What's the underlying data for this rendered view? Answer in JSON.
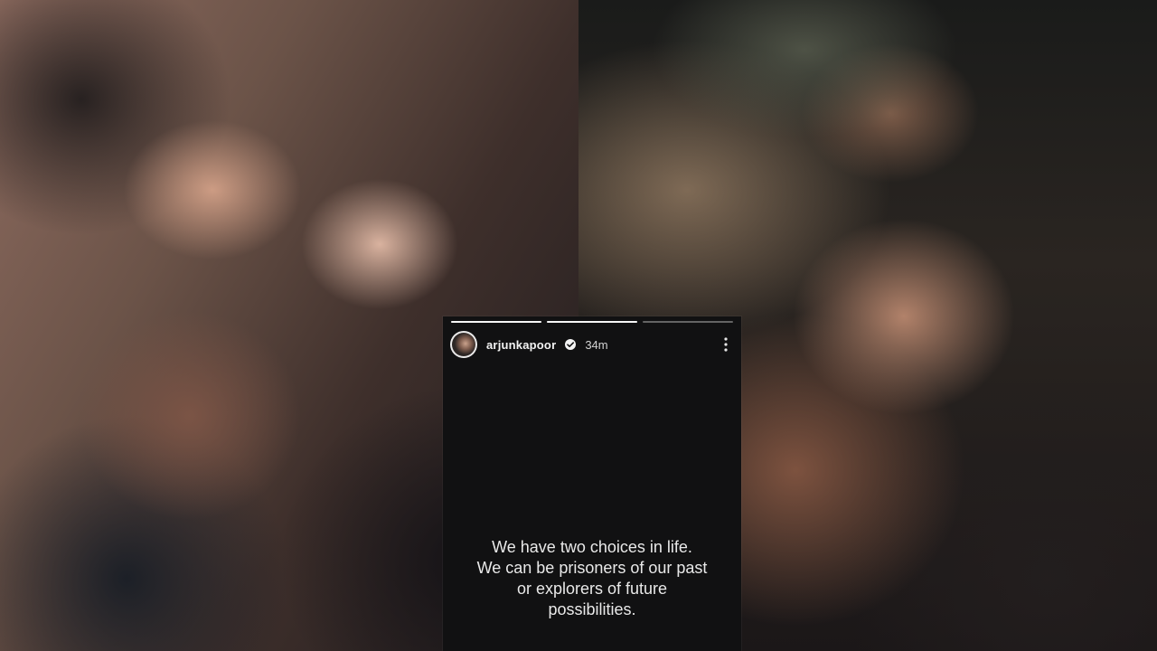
{
  "story": {
    "username": "arjunkapoor",
    "time_ago": "34m",
    "progress": {
      "segments": [
        1,
        1,
        0
      ]
    },
    "caption": "We have two choices in life.\nWe can be prisoners of our past\nor explorers of future\npossibilities."
  },
  "icons": {
    "verified": "verified-badge-icon",
    "more": "more-vertical-icon"
  },
  "colors": {
    "story_background": "#111112",
    "text": "#e9e9e9"
  }
}
